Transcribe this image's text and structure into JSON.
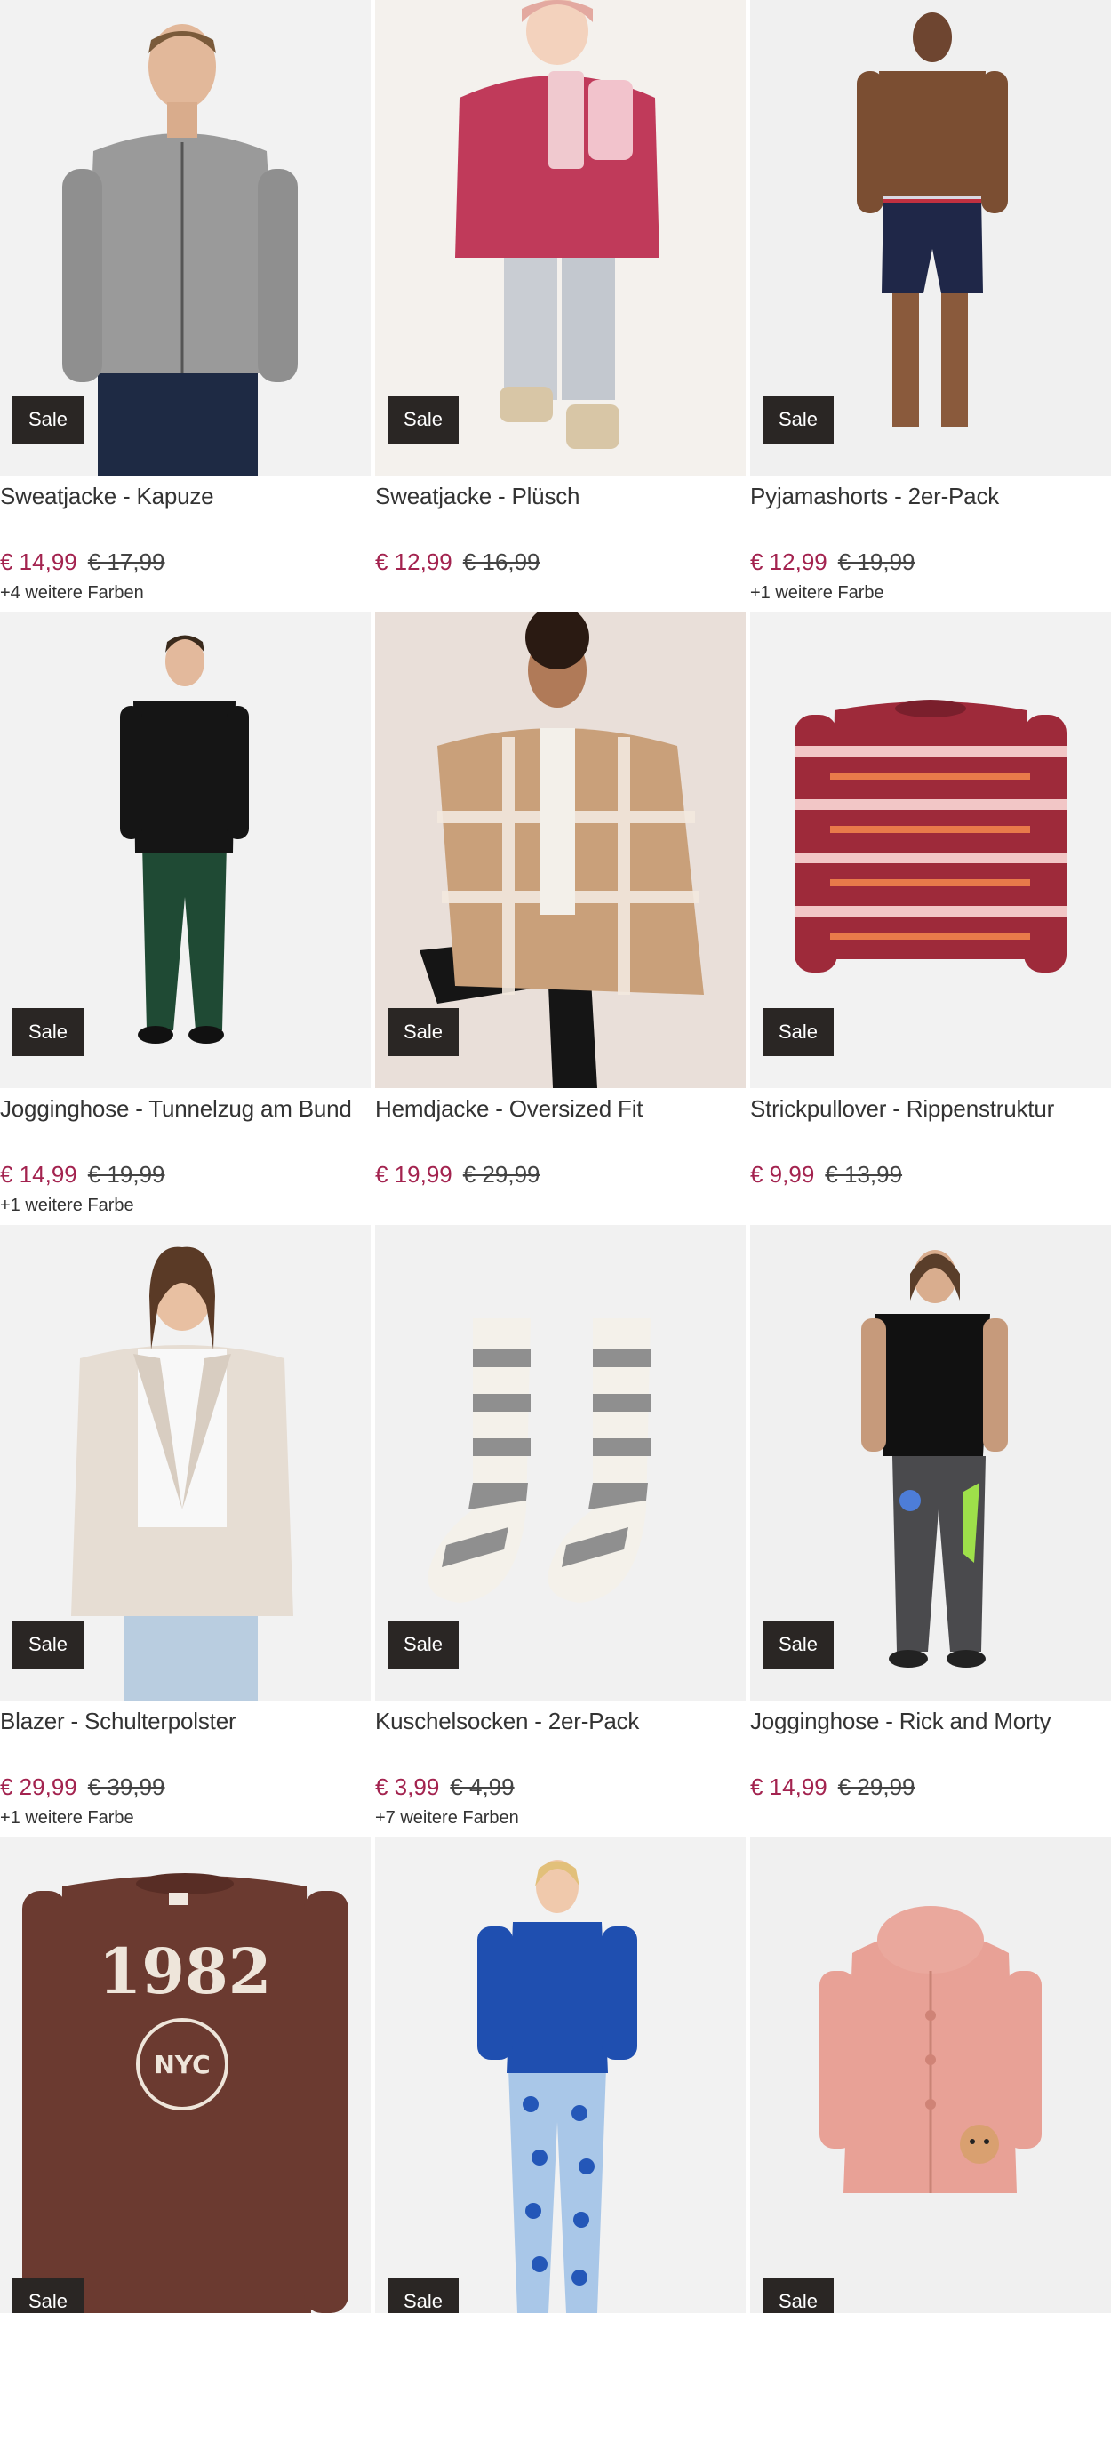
{
  "products": [
    {
      "title": "Sweatjacke - Kapuze",
      "price": "€ 14,99",
      "old_price": "€ 17,99",
      "colors": "+4 weitere Farben",
      "badge": "Sale"
    },
    {
      "title": "Sweatjacke - Plüsch",
      "price": "€ 12,99",
      "old_price": "€ 16,99",
      "colors": "",
      "badge": "Sale"
    },
    {
      "title": "Pyjamashorts - 2er-Pack",
      "price": "€ 12,99",
      "old_price": "€ 19,99",
      "colors": "+1 weitere Farbe",
      "badge": "Sale"
    },
    {
      "title": "Jogginghose - Tunnelzug am Bund",
      "price": "€ 14,99",
      "old_price": "€ 19,99",
      "colors": "+1 weitere Farbe",
      "badge": "Sale"
    },
    {
      "title": "Hemdjacke - Oversized Fit",
      "price": "€ 19,99",
      "old_price": "€ 29,99",
      "colors": "",
      "badge": "Sale"
    },
    {
      "title": "Strickpullover - Rippenstruktur",
      "price": "€ 9,99",
      "old_price": "€ 13,99",
      "colors": "",
      "badge": "Sale"
    },
    {
      "title": "Blazer - Schulterpolster",
      "price": "€ 29,99",
      "old_price": "€ 39,99",
      "colors": "+1 weitere Farbe",
      "badge": "Sale"
    },
    {
      "title": "Kuschelsocken - 2er-Pack",
      "price": "€ 3,99",
      "old_price": "€ 4,99",
      "colors": "+7 weitere Farben",
      "badge": "Sale"
    },
    {
      "title": "Jogginghose - Rick and Morty",
      "price": "€ 14,99",
      "old_price": "€ 29,99",
      "colors": "",
      "badge": "Sale"
    },
    {
      "title": "",
      "price": "",
      "old_price": "",
      "colors": "",
      "badge": "Sale",
      "print_text": "1982",
      "print_sub": "NYC"
    },
    {
      "title": "",
      "price": "",
      "old_price": "",
      "colors": "",
      "badge": "Sale"
    },
    {
      "title": "",
      "price": "",
      "old_price": "",
      "colors": "",
      "badge": "Sale"
    }
  ],
  "colors": {
    "price": "#a3234f",
    "badge_bg": "#2a2624",
    "image_bg": "#f1f1f1"
  }
}
